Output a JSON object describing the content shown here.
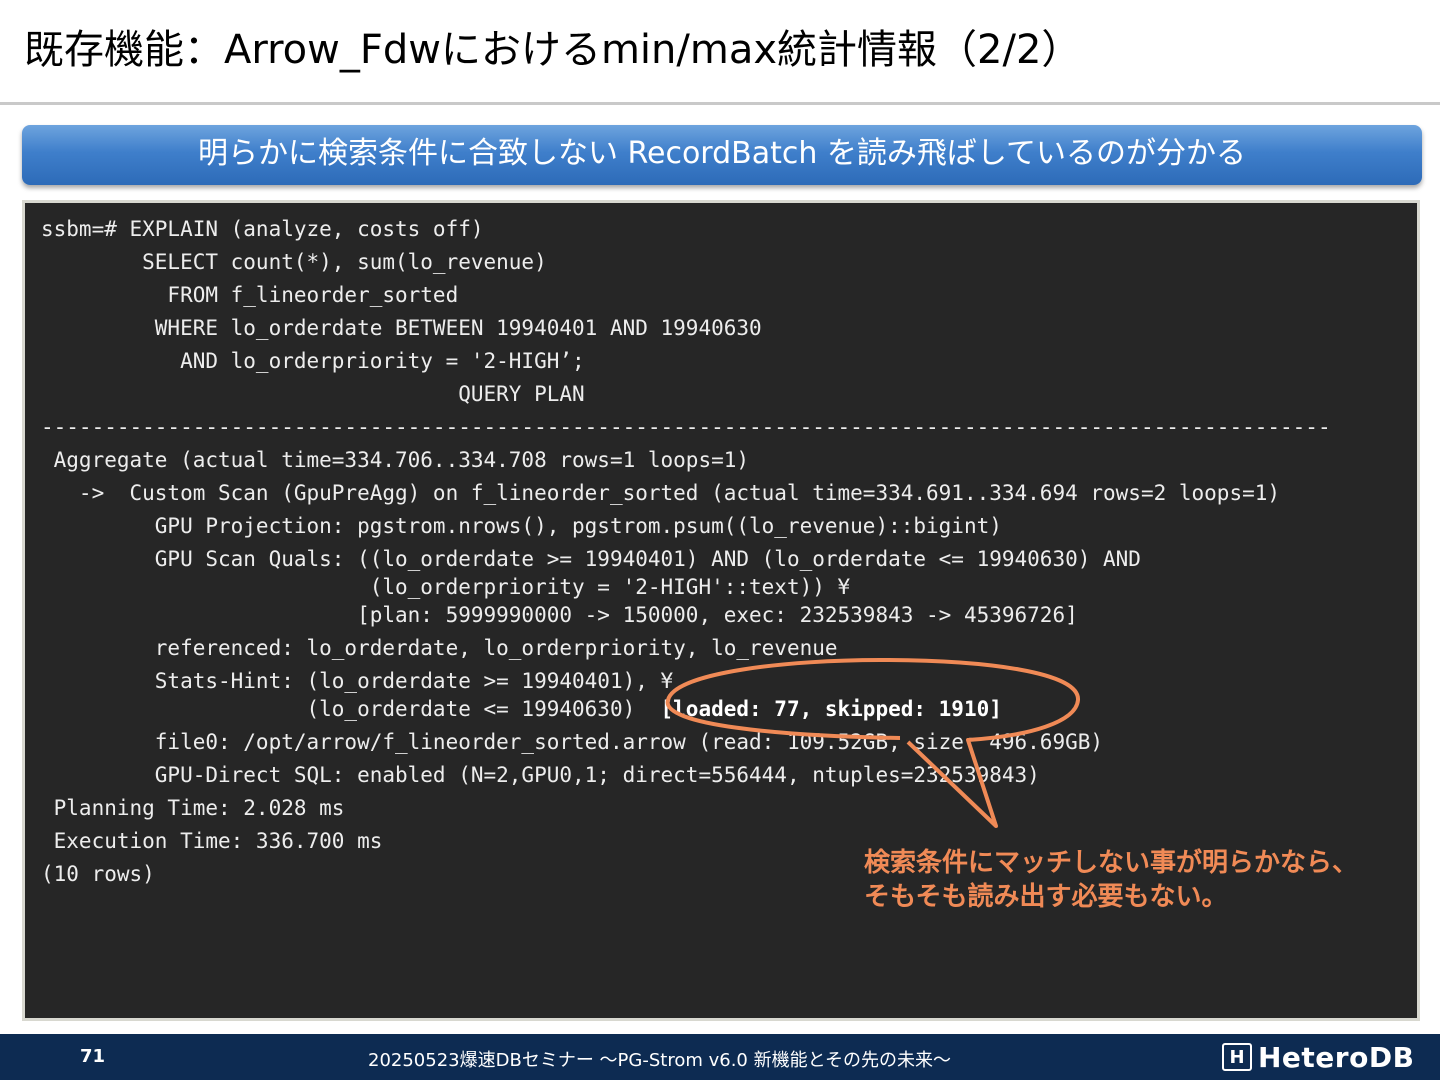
{
  "slide": {
    "title": "既存機能：Arrow_Fdwにおけるmin/max統計情報（2/2）",
    "banner": "明らかに検索条件に合致しない RecordBatch を読み飛ばしているのが分かる"
  },
  "terminal": {
    "lines": [
      "ssbm=# EXPLAIN (analyze, costs off)",
      "        SELECT count(*), sum(lo_revenue)",
      "          FROM f_lineorder_sorted",
      "         WHERE lo_orderdate BETWEEN 19940401 AND 19940630",
      "           AND lo_orderpriority = '2-HIGH’;",
      "                                 QUERY PLAN",
      "------------------------------------------------------------------------------------------------------",
      " Aggregate (actual time=334.706..334.708 rows=1 loops=1)",
      "   ->  Custom Scan (GpuPreAgg) on f_lineorder_sorted (actual time=334.691..334.694 rows=2 loops=1)",
      "         GPU Projection: pgstrom.nrows(), pgstrom.psum((lo_revenue)::bigint)",
      "         GPU Scan Quals: ((lo_orderdate >= 19940401) AND (lo_orderdate <= 19940630) AND",
      "                          (lo_orderpriority = '2-HIGH'::text)) ¥",
      "                         [plan: 5999990000 -> 150000, exec: 232539843 -> 45396726]",
      "         referenced: lo_orderdate, lo_orderpriority, lo_revenue",
      "         Stats-Hint: (lo_orderdate >= 19940401), ¥",
      "                     (lo_orderdate <= 19940630)  ",
      "         file0: /opt/arrow/f_lineorder_sorted.arrow (read: 109.52GB, size: 496.69GB)",
      "         GPU-Direct SQL: enabled (N=2,GPU0,1; direct=556444, ntuples=232539843)",
      " Planning Time: 2.028 ms",
      " Execution Time: 336.700 ms",
      "(10 rows)"
    ],
    "highlight": "[loaded: 77, skipped: 1910]"
  },
  "callout": {
    "line1": "検索条件にマッチしない事が明らかなら、",
    "line2": "そもそも読み出す必要もない。",
    "color": "#f08a56"
  },
  "footer": {
    "page": "71",
    "text": "20250523爆速DBセミナー ～PG-Strom v6.0  新機能とその先の未来～",
    "logo_text": "HeteroDB",
    "background": "#0d2b52"
  }
}
